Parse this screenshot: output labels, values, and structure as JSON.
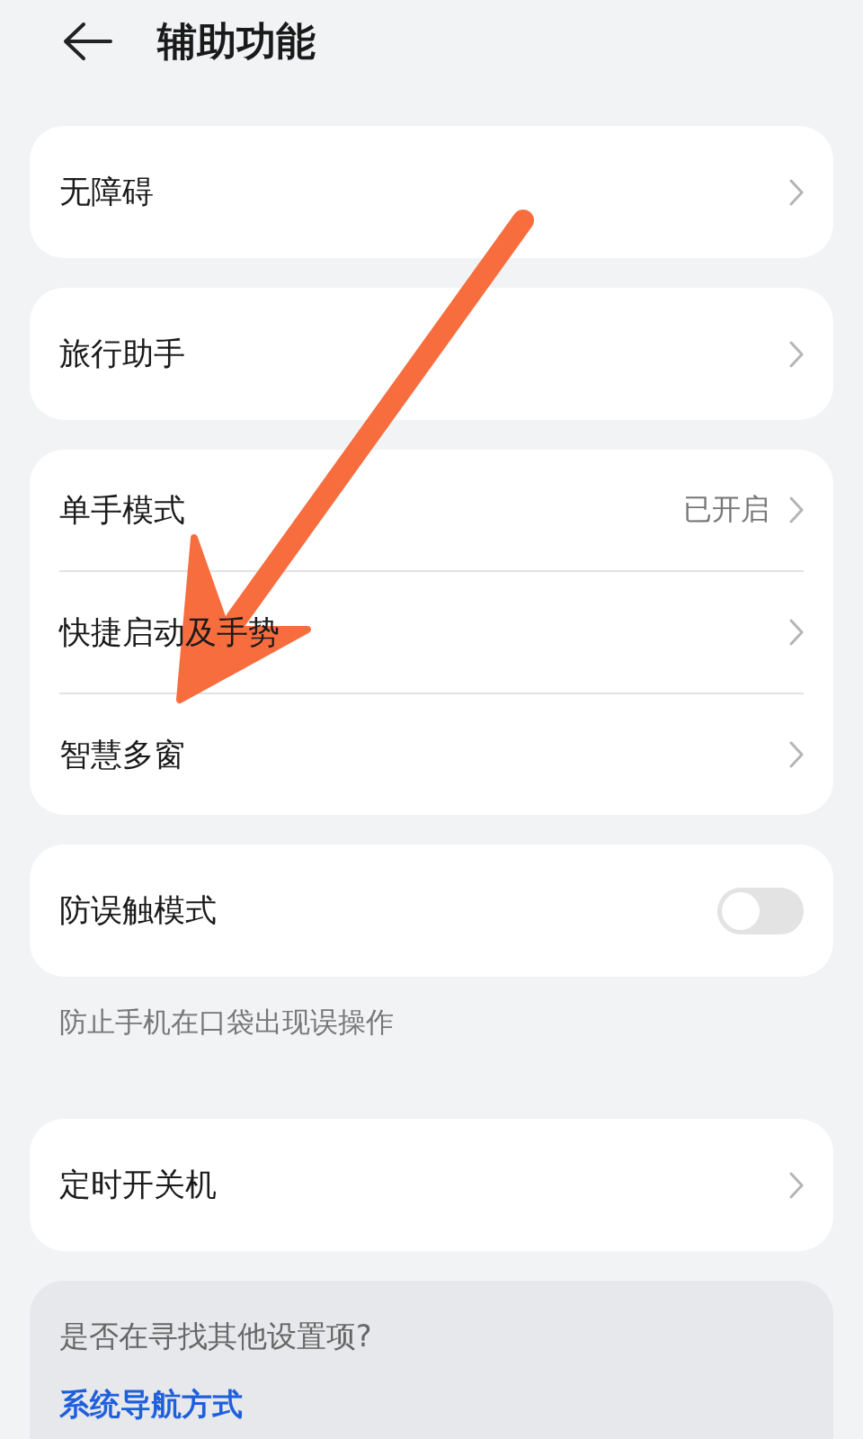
{
  "header": {
    "title": "辅助功能"
  },
  "groups": [
    {
      "items": [
        {
          "kind": "link",
          "label": "无障碍"
        }
      ]
    },
    {
      "items": [
        {
          "kind": "link",
          "label": "旅行助手"
        }
      ]
    },
    {
      "items": [
        {
          "kind": "link",
          "label": "单手模式",
          "value": "已开启"
        },
        {
          "kind": "link",
          "label": "快捷启动及手势"
        },
        {
          "kind": "link",
          "label": "智慧多窗"
        }
      ]
    },
    {
      "items": [
        {
          "kind": "toggle",
          "label": "防误触模式",
          "on": false
        }
      ],
      "note": "防止手机在口袋出现误操作"
    },
    {
      "items": [
        {
          "kind": "link",
          "label": "定时开关机"
        }
      ]
    }
  ],
  "suggestion": {
    "question": "是否在寻找其他设置项?",
    "link": "系统导航方式"
  }
}
